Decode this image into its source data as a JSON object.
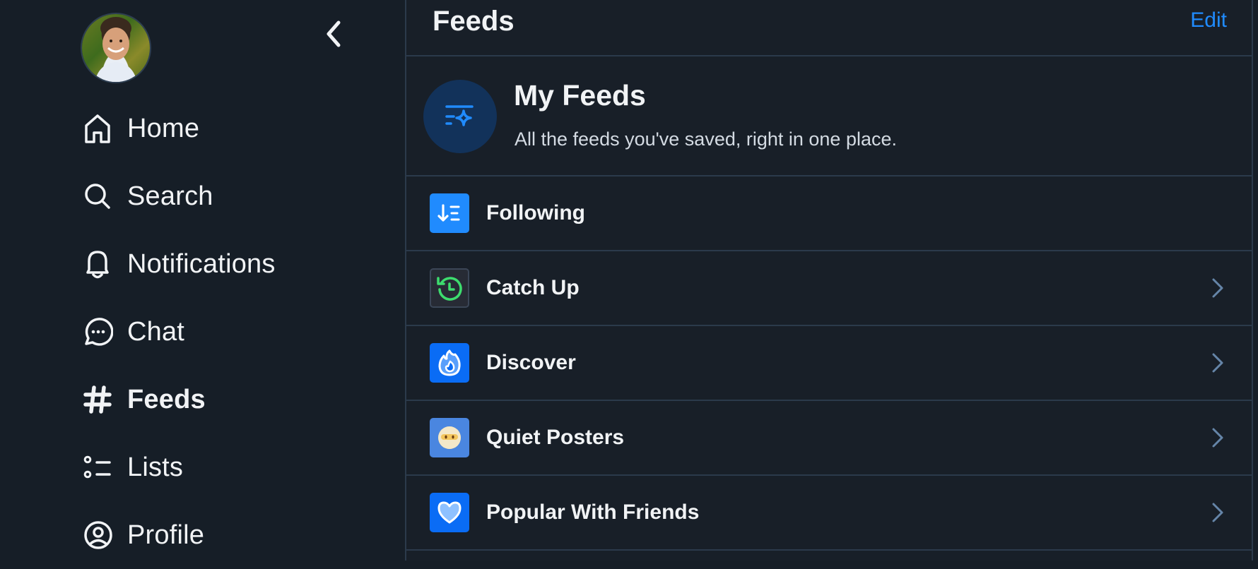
{
  "sidebar": {
    "avatar_alt": "User avatar",
    "back_icon": "chevron-left-icon",
    "items": [
      {
        "label": "Home",
        "icon": "home-icon",
        "active": false
      },
      {
        "label": "Search",
        "icon": "search-icon",
        "active": false
      },
      {
        "label": "Notifications",
        "icon": "bell-icon",
        "active": false
      },
      {
        "label": "Chat",
        "icon": "chat-bubble-icon",
        "active": false
      },
      {
        "label": "Feeds",
        "icon": "hashtag-icon",
        "active": true
      },
      {
        "label": "Lists",
        "icon": "list-icon",
        "active": false
      },
      {
        "label": "Profile",
        "icon": "user-circle-icon",
        "active": false
      }
    ]
  },
  "header": {
    "title": "Feeds",
    "edit_label": "Edit"
  },
  "my_feeds": {
    "title": "My Feeds",
    "subtitle": "All the feeds you've saved, right in one place.",
    "icon": "feed-sparkle-icon"
  },
  "feeds": [
    {
      "label": "Following",
      "icon": "sort-down-icon",
      "icon_bg": "#208bfe",
      "has_chevron": false
    },
    {
      "label": "Catch Up",
      "icon": "clock-rewind-icon",
      "icon_bg": "#272b35",
      "has_chevron": true
    },
    {
      "label": "Discover",
      "icon": "flame-icon",
      "icon_bg": "#0a6cf5",
      "has_chevron": true
    },
    {
      "label": "Quiet Posters",
      "icon": "foggy-face-emoji-icon",
      "icon_bg": "#4a86e0",
      "has_chevron": true
    },
    {
      "label": "Popular With Friends",
      "icon": "heart-icon",
      "icon_bg": "#0a6cf5",
      "has_chevron": true
    }
  ],
  "colors": {
    "accent": "#208bfe",
    "background": "#161e27",
    "border": "#2b3a4b",
    "chevron": "#6585a8",
    "catchup_green": "#3ddc6e"
  }
}
